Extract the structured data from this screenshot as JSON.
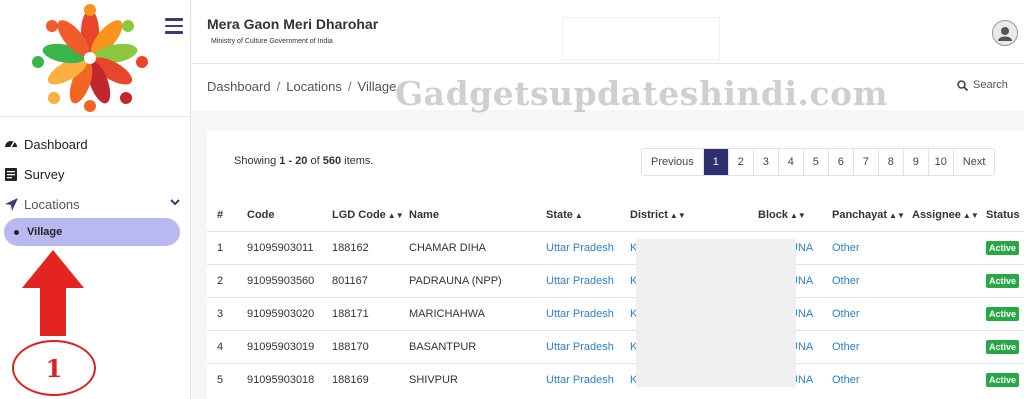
{
  "header": {
    "app_title": "Mera Gaon Meri Dharohar",
    "app_subtitle": "Ministry of Culture Government of India"
  },
  "sidebar": {
    "items": [
      {
        "label": "Dashboard",
        "icon": "dashboard-icon"
      },
      {
        "label": "Survey",
        "icon": "survey-icon"
      },
      {
        "label": "Locations",
        "icon": "location-arrow-icon"
      }
    ],
    "sub_item": "Village"
  },
  "breadcrumb": {
    "items": [
      "Dashboard",
      "Locations",
      "Village"
    ],
    "separator": "/"
  },
  "search_label": "Search",
  "watermark": "Gadgetsupdateshindi.com",
  "annotation_number": "1",
  "listing": {
    "showing_prefix": "Showing ",
    "range": "1 - 20",
    "of": " of ",
    "total": "560",
    "suffix": " items."
  },
  "pagination": {
    "previous": "Previous",
    "pages": [
      "1",
      "2",
      "3",
      "4",
      "5",
      "6",
      "7",
      "8",
      "9",
      "10"
    ],
    "current": "1",
    "next": "Next"
  },
  "table": {
    "columns": [
      "#",
      "Code",
      "LGD Code",
      "Name",
      "State",
      "District",
      "Block",
      "Panchayat",
      "Assignee",
      "Status"
    ],
    "rows": [
      {
        "num": "1",
        "code": "91095903011",
        "lgd": "188162",
        "name": "CHAMAR DIHA",
        "state": "Uttar Pradesh",
        "district": "K",
        "block": "UNA",
        "panchayat": "Other",
        "assignee": "",
        "status": "Active"
      },
      {
        "num": "2",
        "code": "91095903560",
        "lgd": "801167",
        "name": "PADRAUNA (NPP)",
        "state": "Uttar Pradesh",
        "district": "K",
        "block": "UNA",
        "panchayat": "Other",
        "assignee": "",
        "status": "Active"
      },
      {
        "num": "3",
        "code": "91095903020",
        "lgd": "188171",
        "name": "MARICHAHWA",
        "state": "Uttar Pradesh",
        "district": "K",
        "block": "UNA",
        "panchayat": "Other",
        "assignee": "",
        "status": "Active"
      },
      {
        "num": "4",
        "code": "91095903019",
        "lgd": "188170",
        "name": "BASANTPUR",
        "state": "Uttar Pradesh",
        "district": "K",
        "block": "UNA",
        "panchayat": "Other",
        "assignee": "",
        "status": "Active"
      },
      {
        "num": "5",
        "code": "91095903018",
        "lgd": "188169",
        "name": "SHIVPUR",
        "state": "Uttar Pradesh",
        "district": "K",
        "block": "UNA",
        "panchayat": "Other",
        "assignee": "",
        "status": "Active"
      }
    ]
  },
  "colors": {
    "brand": "#2f2f6e",
    "link": "#2f7fd1",
    "active_badge": "#28a745",
    "annotation_red": "#d8221f",
    "sidebar_highlight": "#b9b8f0"
  }
}
